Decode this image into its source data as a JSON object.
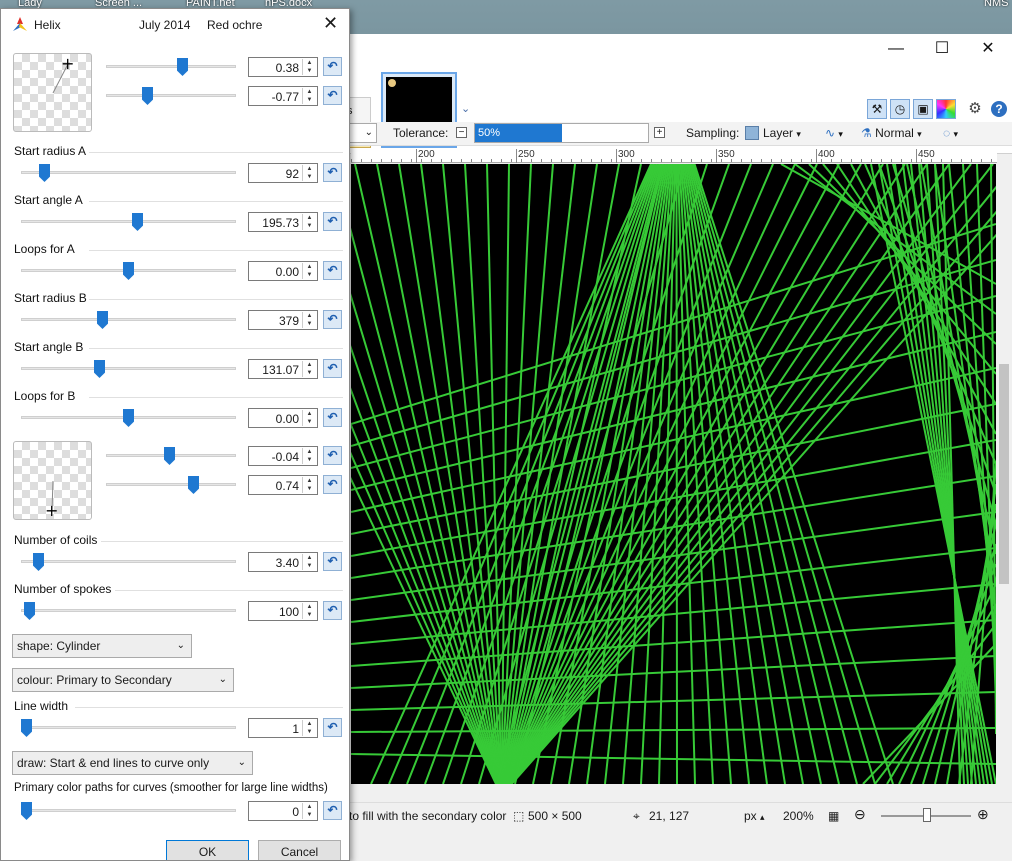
{
  "desktop": {
    "labels": [
      "Lady",
      "Screen ...",
      "PAINT.net",
      "nPS.docx",
      "NMS"
    ]
  },
  "helix": {
    "title": "Helix",
    "date": "July 2014",
    "author": "Red ochre",
    "close": "✕",
    "pad1": {
      "x_value": "0.38",
      "y_value": "-0.77"
    },
    "start_radius_a": {
      "label": "Start radius A",
      "value": "92"
    },
    "start_angle_a": {
      "label": "Start angle A",
      "value": "195.73"
    },
    "loops_a": {
      "label": "Loops for A",
      "value": "0.00"
    },
    "start_radius_b": {
      "label": "Start radius B",
      "value": "379"
    },
    "start_angle_b": {
      "label": "Start angle B",
      "value": "131.07"
    },
    "loops_b": {
      "label": "Loops for B",
      "value": "0.00"
    },
    "pad2": {
      "x_value": "-0.04",
      "y_value": "0.74"
    },
    "coils": {
      "label": "Number of coils",
      "value": "3.40"
    },
    "spokes": {
      "label": "Number of spokes",
      "value": "100"
    },
    "shape": "shape: Cylinder",
    "colour": "colour: Primary to Secondary",
    "line_width": {
      "label": "Line width",
      "value": "1"
    },
    "draw": "draw: Start & end lines to curve only",
    "paths": {
      "label": "Primary color paths for curves (smoother for large line widths)",
      "value": "0"
    },
    "ok": "OK",
    "cancel": "Cancel"
  },
  "pdn": {
    "tab_fragment": "ts",
    "toolbar": {
      "tolerance_label": "Tolerance:",
      "tolerance_value": "50%",
      "sampling_label": "Sampling:",
      "sampling_value": "Layer",
      "blend_mode": "Normal"
    },
    "ruler_ticks": [
      "200",
      "250",
      "300",
      "350",
      "400",
      "450"
    ],
    "status": {
      "hint": "to fill with the secondary color",
      "image_size": "500 × 500",
      "cursor": "21, 127",
      "units": "px",
      "zoom": "200%"
    },
    "colors": {
      "accent": "#1f78d1",
      "line": "#3de03d",
      "canvas": "#000000"
    }
  }
}
